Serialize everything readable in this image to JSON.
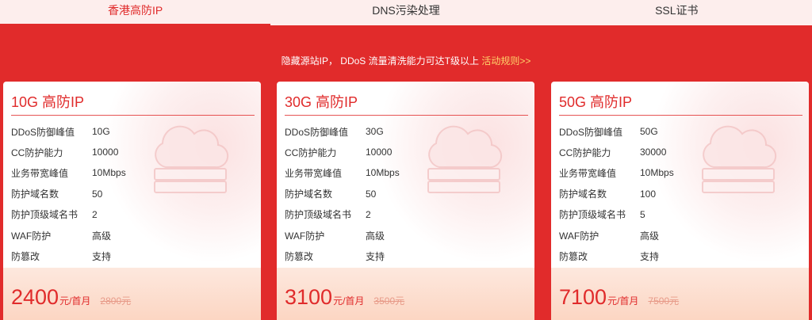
{
  "tabs": [
    {
      "label": "香港高防IP",
      "active": true
    },
    {
      "label": "DNS污染处理",
      "active": false
    },
    {
      "label": "SSL证书",
      "active": false
    }
  ],
  "notice": {
    "text": "隐藏源站IP， DDoS 流量清洗能力可达T级以上",
    "link": "活动规则>>"
  },
  "cards": [
    {
      "title": "10G 高防IP",
      "specs": [
        {
          "label": "DDoS防御峰值",
          "value": "10G"
        },
        {
          "label": "CC防护能力",
          "value": "10000"
        },
        {
          "label": "业务带宽峰值",
          "value": "10Mbps"
        },
        {
          "label": "防护域名数",
          "value": "50"
        },
        {
          "label": "防护顶级域名书",
          "value": "2"
        },
        {
          "label": "WAF防护",
          "value": "高级"
        },
        {
          "label": "防篡改",
          "value": "支持"
        }
      ],
      "price": "2400",
      "unit": "元/首月",
      "old_price": "2800元"
    },
    {
      "title": "30G 高防IP",
      "specs": [
        {
          "label": "DDoS防御峰值",
          "value": "30G"
        },
        {
          "label": "CC防护能力",
          "value": "10000"
        },
        {
          "label": "业务带宽峰值",
          "value": "10Mbps"
        },
        {
          "label": "防护域名数",
          "value": "50"
        },
        {
          "label": "防护顶级域名书",
          "value": "2"
        },
        {
          "label": "WAF防护",
          "value": "高级"
        },
        {
          "label": "防篡改",
          "value": "支持"
        }
      ],
      "price": "3100",
      "unit": "元/首月",
      "old_price": "3500元"
    },
    {
      "title": "50G 高防IP",
      "specs": [
        {
          "label": "DDoS防御峰值",
          "value": "50G"
        },
        {
          "label": "CC防护能力",
          "value": "30000"
        },
        {
          "label": "业务带宽峰值",
          "value": "10Mbps"
        },
        {
          "label": "防护域名数",
          "value": "100"
        },
        {
          "label": "防护顶级域名书",
          "value": "5"
        },
        {
          "label": "WAF防护",
          "value": "高级"
        },
        {
          "label": "防篡改",
          "value": "支持"
        }
      ],
      "price": "7100",
      "unit": "元/首月",
      "old_price": "7500元"
    }
  ],
  "colors": {
    "brand_red": "#e02b2b",
    "tab_bg": "#fdeeed",
    "link_yellow": "#ffd36a"
  },
  "icons": {
    "card_decoration": "cloud-server-icon"
  }
}
